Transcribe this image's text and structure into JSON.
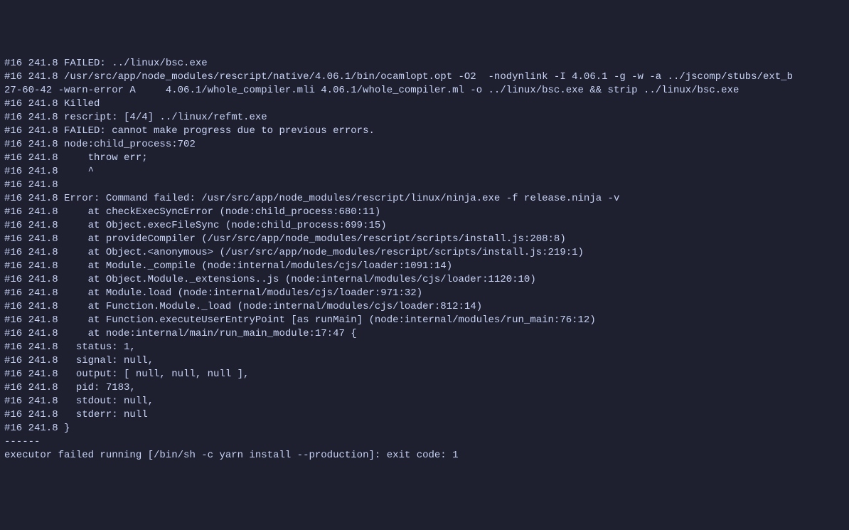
{
  "lines": [
    "#16 241.8 FAILED: ../linux/bsc.exe",
    "#16 241.8 /usr/src/app/node_modules/rescript/native/4.06.1/bin/ocamlopt.opt -O2  -nodynlink -I 4.06.1 -g -w -a ../jscomp/stubs/ext_b",
    "27-60-42 -warn-error A     4.06.1/whole_compiler.mli 4.06.1/whole_compiler.ml -o ../linux/bsc.exe && strip ../linux/bsc.exe",
    "#16 241.8 Killed",
    "#16 241.8 rescript: [4/4] ../linux/refmt.exe",
    "#16 241.8 FAILED: cannot make progress due to previous errors.",
    "#16 241.8 node:child_process:702",
    "#16 241.8     throw err;",
    "#16 241.8     ^",
    "#16 241.8",
    "#16 241.8 Error: Command failed: /usr/src/app/node_modules/rescript/linux/ninja.exe -f release.ninja -v",
    "#16 241.8     at checkExecSyncError (node:child_process:680:11)",
    "#16 241.8     at Object.execFileSync (node:child_process:699:15)",
    "#16 241.8     at provideCompiler (/usr/src/app/node_modules/rescript/scripts/install.js:208:8)",
    "#16 241.8     at Object.<anonymous> (/usr/src/app/node_modules/rescript/scripts/install.js:219:1)",
    "#16 241.8     at Module._compile (node:internal/modules/cjs/loader:1091:14)",
    "#16 241.8     at Object.Module._extensions..js (node:internal/modules/cjs/loader:1120:10)",
    "#16 241.8     at Module.load (node:internal/modules/cjs/loader:971:32)",
    "#16 241.8     at Function.Module._load (node:internal/modules/cjs/loader:812:14)",
    "#16 241.8     at Function.executeUserEntryPoint [as runMain] (node:internal/modules/run_main:76:12)",
    "#16 241.8     at node:internal/main/run_main_module:17:47 {",
    "#16 241.8   status: 1,",
    "#16 241.8   signal: null,",
    "#16 241.8   output: [ null, null, null ],",
    "#16 241.8   pid: 7183,",
    "#16 241.8   stdout: null,",
    "#16 241.8   stderr: null",
    "#16 241.8 }",
    "------",
    "executor failed running [/bin/sh -c yarn install --production]: exit code: 1"
  ]
}
